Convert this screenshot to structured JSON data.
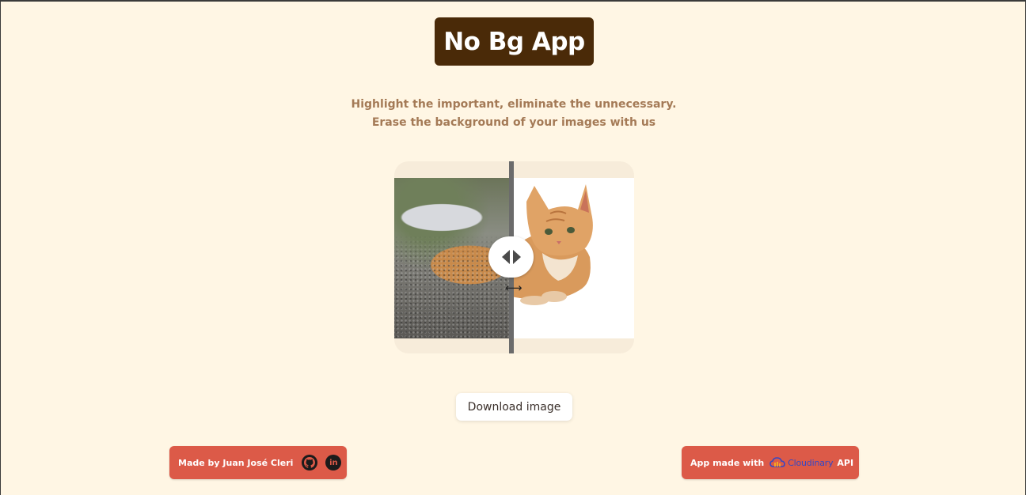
{
  "header": {
    "title": "No Bg App"
  },
  "tagline": {
    "line1": "Highlight the important, eliminate the unnecessary.",
    "line2": "Erase the background of your images with us"
  },
  "compare": {
    "handle_icon": "left-right-arrows-icon"
  },
  "download": {
    "label": "Download image"
  },
  "footer": {
    "author_label": "Made by Juan José Cleri",
    "github_icon": "github-icon",
    "linkedin_icon": "linkedin-icon",
    "linkedin_text": "in",
    "api_prefix": "App made with",
    "api_brand": "Cloudinary",
    "api_suffix": "API"
  },
  "colors": {
    "background": "#fff6e4",
    "logo_bg": "#4a2a08",
    "tagline": "#a47a56",
    "pill": "#dc5a48"
  }
}
